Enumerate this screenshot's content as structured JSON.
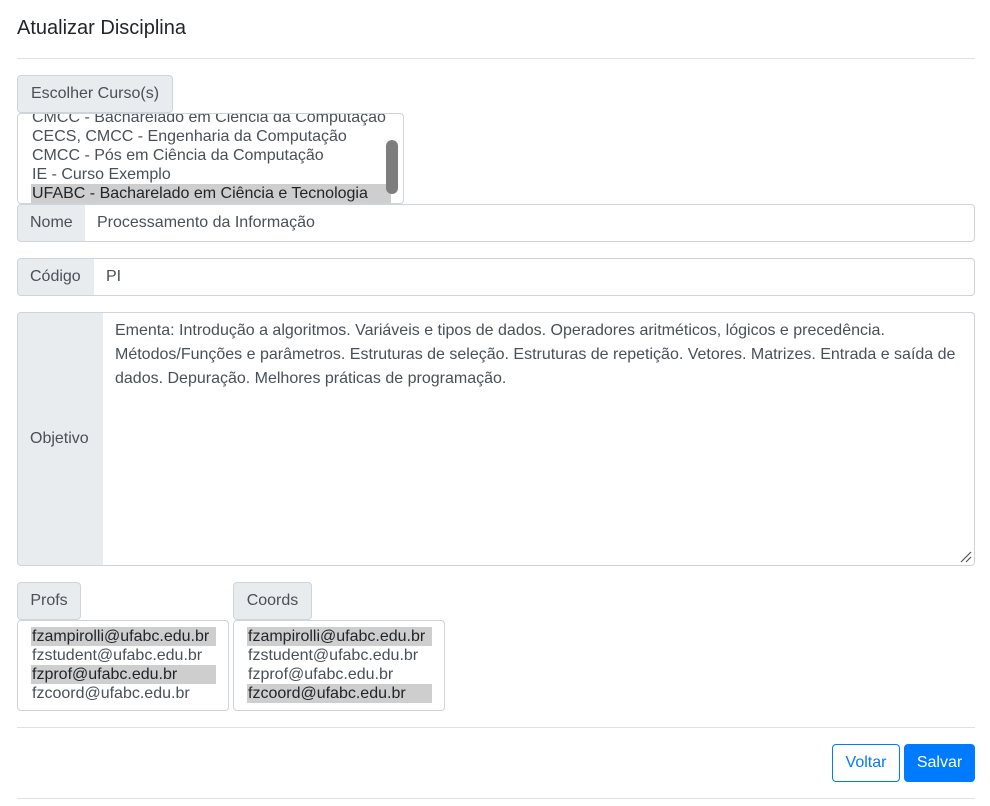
{
  "page": {
    "title": "Atualizar Disciplina"
  },
  "cursos": {
    "button_label": "Escolher Curso(s)",
    "options": [
      {
        "label": "CMCC - Bacharelado em Ciência da Computação",
        "selected": false
      },
      {
        "label": "CECS, CMCC - Engenharia da Computação",
        "selected": false
      },
      {
        "label": "CMCC - Pós em Ciência da Computação",
        "selected": false
      },
      {
        "label": "IE - Curso Exemplo",
        "selected": false
      },
      {
        "label": "UFABC - Bacharelado em Ciência e Tecnologia",
        "selected": true
      }
    ]
  },
  "form": {
    "nome": {
      "label": "Nome",
      "value": "Processamento da Informação"
    },
    "codigo": {
      "label": "Código",
      "value": "PI"
    },
    "objetivo": {
      "label": "Objetivo",
      "value": "Ementa: Introdução a algoritmos. Variáveis e tipos de dados. Operadores aritméticos, lógicos e precedência. Métodos/Funções e parâmetros. Estruturas de seleção. Estruturas de repetição. Vetores. Matrizes. Entrada e saída de dados. Depuração. Melhores práticas de programação."
    }
  },
  "profs": {
    "label": "Profs",
    "options": [
      {
        "label": "fzampirolli@ufabc.edu.br",
        "selected": true
      },
      {
        "label": "fzstudent@ufabc.edu.br",
        "selected": false
      },
      {
        "label": "fzprof@ufabc.edu.br",
        "selected": true
      },
      {
        "label": "fzcoord@ufabc.edu.br",
        "selected": false
      }
    ]
  },
  "coords": {
    "label": "Coords",
    "options": [
      {
        "label": "fzampirolli@ufabc.edu.br",
        "selected": true
      },
      {
        "label": "fzstudent@ufabc.edu.br",
        "selected": false
      },
      {
        "label": "fzprof@ufabc.edu.br",
        "selected": false
      },
      {
        "label": "fzcoord@ufabc.edu.br",
        "selected": true
      }
    ]
  },
  "actions": {
    "back_label": "Voltar",
    "save_label": "Salvar"
  },
  "colors": {
    "primary": "#007bff",
    "addon_bg": "#e9ecef",
    "border": "#ced4da",
    "selected_bg": "#cecece"
  }
}
